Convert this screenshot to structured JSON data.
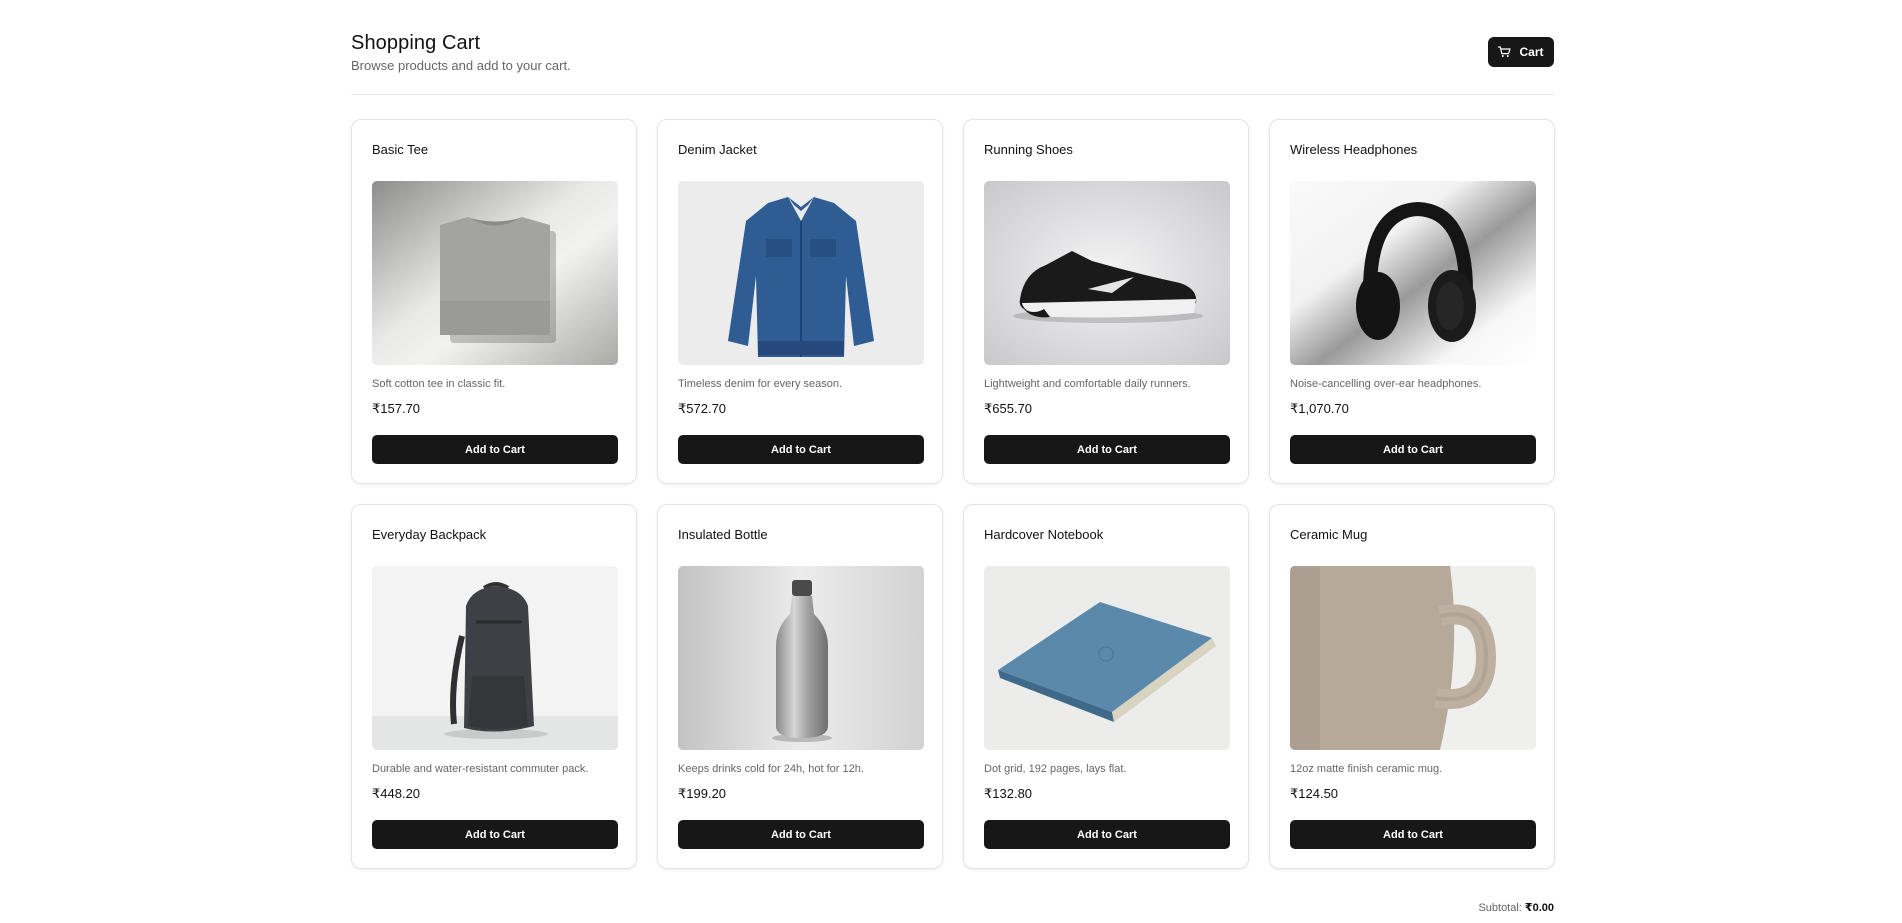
{
  "header": {
    "title": "Shopping Cart",
    "subtitle": "Browse products and add to your cart.",
    "cart_label": "Cart"
  },
  "products": [
    {
      "name": "Basic Tee",
      "description": "Soft cotton tee in classic fit.",
      "price": "₹157.70",
      "button": "Add to Cart",
      "image": "gray-t-shirt"
    },
    {
      "name": "Denim Jacket",
      "description": "Timeless denim for every season.",
      "price": "₹572.70",
      "button": "Add to Cart",
      "image": "denim-jacket"
    },
    {
      "name": "Running Shoes",
      "description": "Lightweight and comfortable daily runners.",
      "price": "₹655.70",
      "button": "Add to Cart",
      "image": "black-running-shoe"
    },
    {
      "name": "Wireless Headphones",
      "description": "Noise-cancelling over-ear headphones.",
      "price": "₹1,070.70",
      "button": "Add to Cart",
      "image": "black-headphones"
    },
    {
      "name": "Everyday Backpack",
      "description": "Durable and water-resistant commuter pack.",
      "price": "₹448.20",
      "button": "Add to Cart",
      "image": "gray-backpack"
    },
    {
      "name": "Insulated Bottle",
      "description": "Keeps drinks cold for 24h, hot for 12h.",
      "price": "₹199.20",
      "button": "Add to Cart",
      "image": "steel-bottle"
    },
    {
      "name": "Hardcover Notebook",
      "description": "Dot grid, 192 pages, lays flat.",
      "price": "₹132.80",
      "button": "Add to Cart",
      "image": "blue-notebook"
    },
    {
      "name": "Ceramic Mug",
      "description": "12oz matte finish ceramic mug.",
      "price": "₹124.50",
      "button": "Add to Cart",
      "image": "beige-mug"
    }
  ],
  "footer": {
    "subtotal_label": "Subtotal:",
    "subtotal_value": "₹0.00"
  },
  "colors": {
    "button_bg": "#171717",
    "card_border": "#e3e3e3",
    "muted_text": "#666666"
  }
}
